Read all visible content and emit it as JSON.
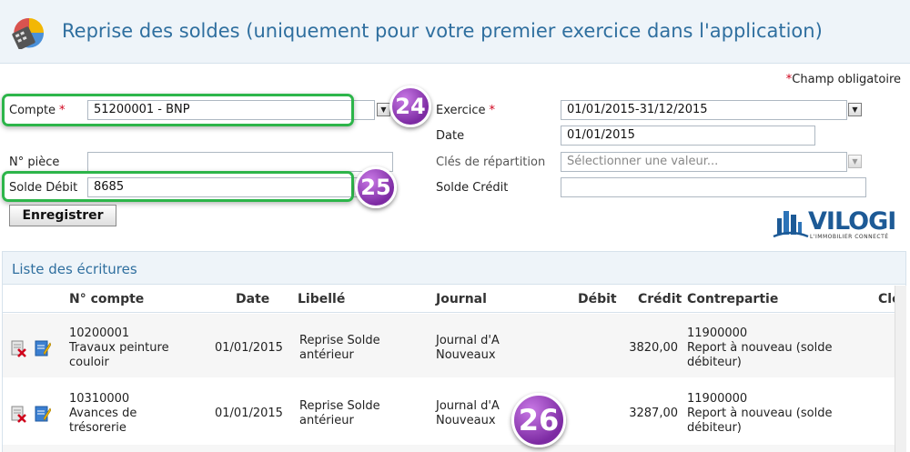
{
  "header": {
    "title": "Reprise des soldes (uniquement pour votre premier exercice dans l'application)",
    "icon": "calculator-chart-icon"
  },
  "form": {
    "required_note": "Champ obligatoire",
    "compte_label": "Compte",
    "compte_value": "51200001 - BNP",
    "exercice_label": "Exercice",
    "exercice_value": "01/01/2015-31/12/2015",
    "date_label": "Date",
    "date_value": "01/01/2015",
    "piece_label": "N° pièce",
    "piece_value": "",
    "cles_label": "Clés de répartition",
    "cles_placeholder": "Sélectionner une valeur...",
    "debit_label": "Solde Débit",
    "debit_value": "8685",
    "credit_label": "Solde Crédit",
    "credit_value": "",
    "save_label": "Enregistrer"
  },
  "badges": {
    "b24": "24",
    "b25": "25",
    "b26": "26"
  },
  "logo": {
    "name": "VILOGI",
    "tagline": "L'IMMOBILIER CONNECTÉ"
  },
  "list": {
    "title": "Liste des écritures",
    "columns": [
      "N° compte",
      "Date",
      "Libellé",
      "Journal",
      "Débit",
      "Crédit",
      "Contrepartie",
      "Clé"
    ],
    "rows": [
      {
        "compte_num": "10200001",
        "compte_name_l1": "Travaux peinture",
        "compte_name_l2": "couloir",
        "date": "01/01/2015",
        "libelle_l1": "Reprise Solde",
        "libelle_l2": "antérieur",
        "journal_l1": "Journal d'A",
        "journal_l2": "Nouveaux",
        "debit": "",
        "credit": "3820,00",
        "contre_num": "11900000",
        "contre_l1": "Report à nouveau (solde",
        "contre_l2": "débiteur)"
      },
      {
        "compte_num": "10310000",
        "compte_name_l1": "Avances de",
        "compte_name_l2": "trésorerie",
        "date": "01/01/2015",
        "libelle_l1": "Reprise Solde",
        "libelle_l2": "antérieur",
        "journal_l1": "Journal d'A",
        "journal_l2": "Nouveaux",
        "debit": "",
        "credit": "3287,00",
        "contre_num": "11900000",
        "contre_l1": "Report à nouveau (solde",
        "contre_l2": "débiteur)"
      }
    ]
  },
  "colors": {
    "title_blue": "#2f6f9f",
    "highlight_green": "#2db54a",
    "badge_purple": "#7d2ba3",
    "required_red": "#d0021b"
  }
}
